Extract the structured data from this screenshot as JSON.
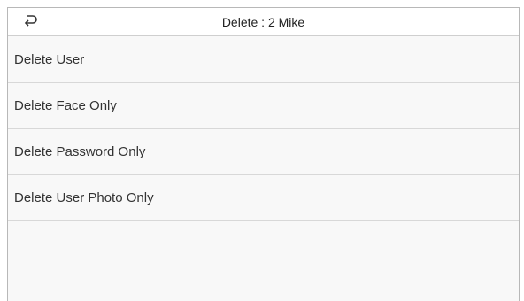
{
  "header": {
    "back_icon": "return-arrow-icon",
    "title": "Delete : 2 Mike"
  },
  "menu": {
    "items": [
      {
        "label": "Delete User"
      },
      {
        "label": "Delete Face Only"
      },
      {
        "label": "Delete Password Only"
      },
      {
        "label": "Delete User Photo Only"
      }
    ]
  },
  "colors": {
    "background": "#f8f8f8",
    "header_background": "#ffffff",
    "divider": "#d8d8d8",
    "text": "#333333"
  }
}
